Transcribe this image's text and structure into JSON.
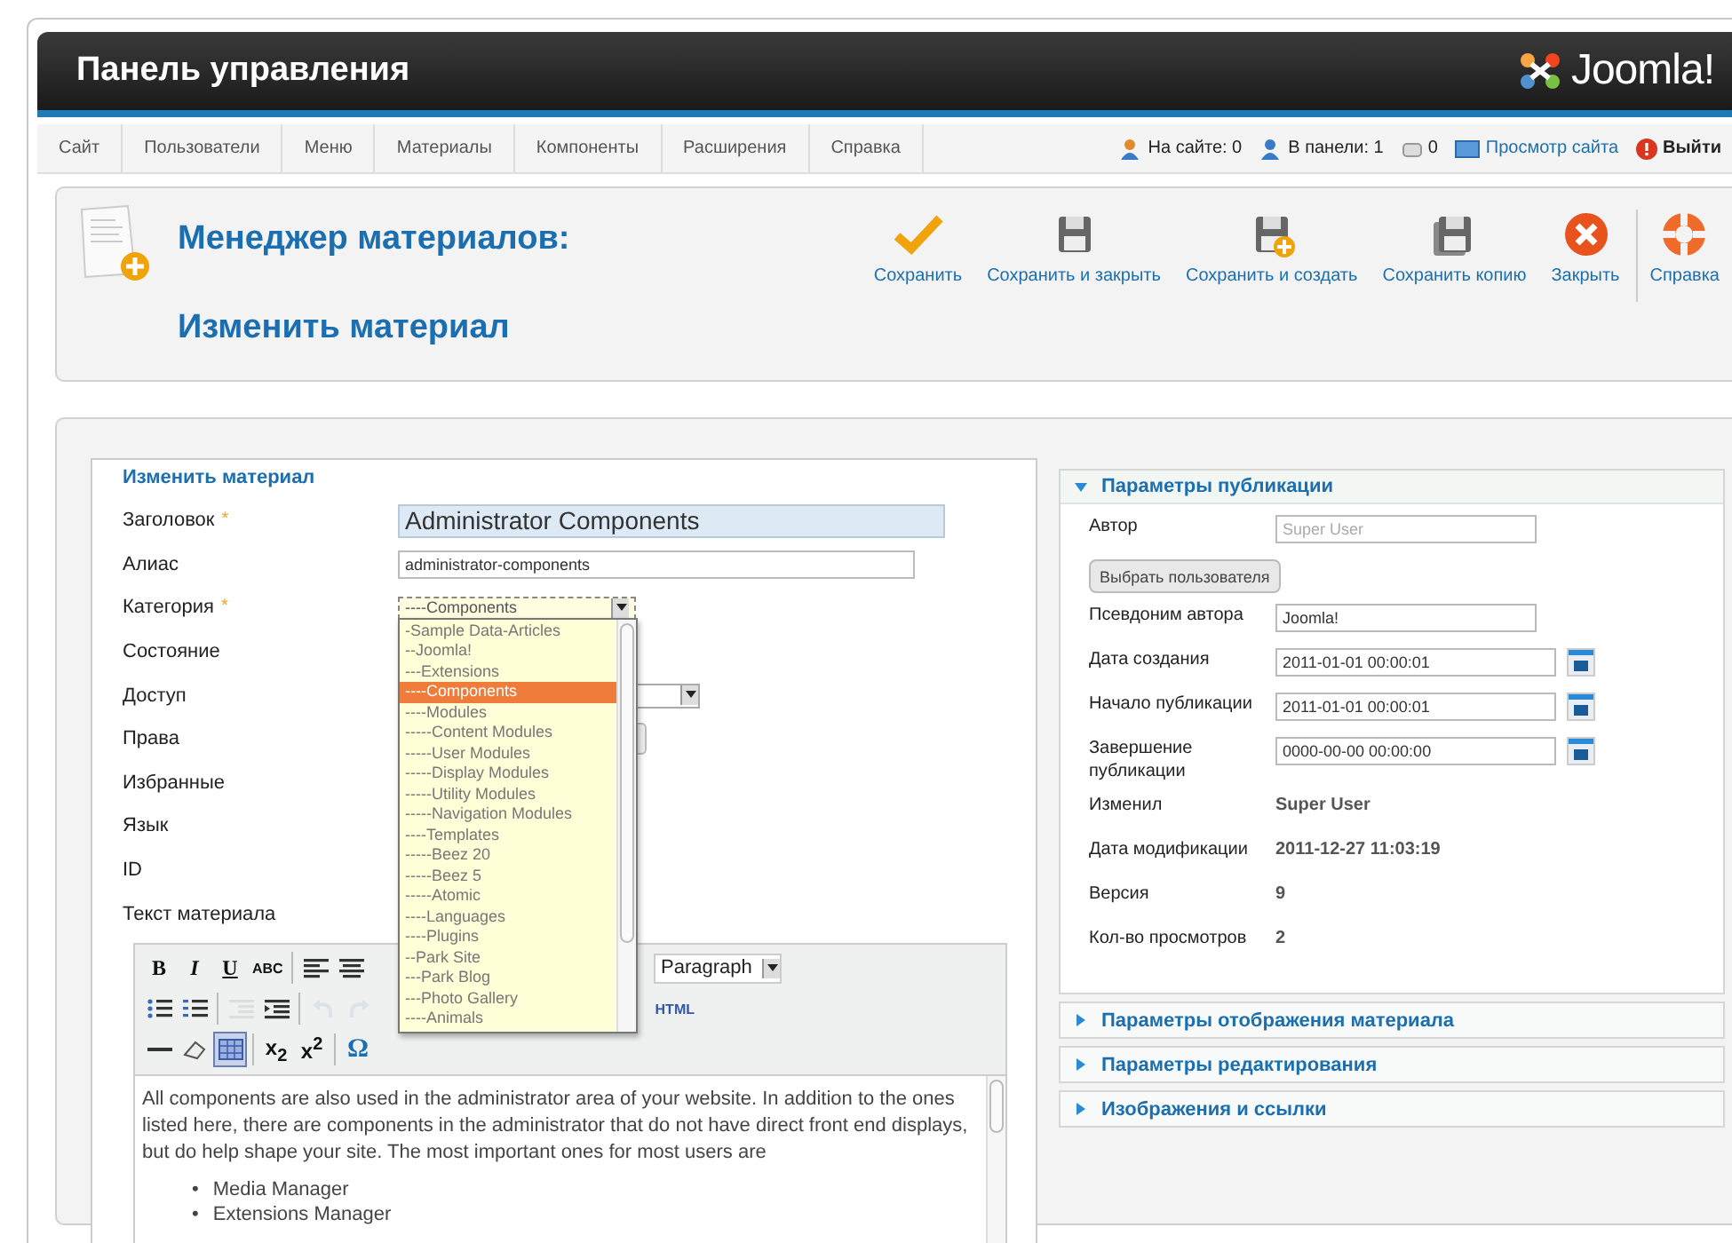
{
  "header": {
    "title": "Панель управления",
    "logo": "Joomla!"
  },
  "menu": [
    {
      "label": "Сайт"
    },
    {
      "label": "Пользователи"
    },
    {
      "label": "Меню"
    },
    {
      "label": "Материалы"
    },
    {
      "label": "Компоненты"
    },
    {
      "label": "Расширения"
    },
    {
      "label": "Справка"
    }
  ],
  "status": [
    {
      "kind": "users",
      "label": "На сайте: 0"
    },
    {
      "kind": "admins",
      "label": "В панели: 1"
    },
    {
      "kind": "messages",
      "label": "0"
    },
    {
      "kind": "preview",
      "label": "Просмотр сайта"
    },
    {
      "kind": "logout",
      "label": "Выйти"
    }
  ],
  "toolbar": {
    "title": "Менеджер материалов:",
    "subtitle": "Изменить материал",
    "buttons": [
      {
        "kind": "save",
        "label": "Сохранить"
      },
      {
        "kind": "save-close",
        "label": "Сохранить и закрыть"
      },
      {
        "kind": "save-new",
        "label": "Сохранить и создать"
      },
      {
        "kind": "save-copy",
        "label": "Сохранить копию"
      },
      {
        "kind": "close",
        "label": "Закрыть"
      },
      {
        "kind": "help",
        "label": "Справка"
      }
    ]
  },
  "form": {
    "legend": "Изменить материал",
    "fields": [
      {
        "kind": "title",
        "label": "Заголовок",
        "required_mark": "*",
        "value": "Administrator Components"
      },
      {
        "kind": "text",
        "label": "Алиас",
        "value": "administrator-components"
      },
      {
        "kind": "category",
        "label": "Категория",
        "required_mark": "*",
        "value": "----Components",
        "options": [
          {
            "label": "-Sample Data-Articles",
            "selected": false
          },
          {
            "label": "--Joomla!",
            "selected": false
          },
          {
            "label": "---Extensions",
            "selected": false
          },
          {
            "label": "----Components",
            "selected": true
          },
          {
            "label": "----Modules",
            "selected": false
          },
          {
            "label": "-----Content Modules",
            "selected": false
          },
          {
            "label": "-----User Modules",
            "selected": false
          },
          {
            "label": "-----Display Modules",
            "selected": false
          },
          {
            "label": "-----Utility Modules",
            "selected": false
          },
          {
            "label": "-----Navigation Modules",
            "selected": false
          },
          {
            "label": "----Templates",
            "selected": false
          },
          {
            "label": "-----Beez 20",
            "selected": false
          },
          {
            "label": "-----Beez 5",
            "selected": false
          },
          {
            "label": "-----Atomic",
            "selected": false
          },
          {
            "label": "----Languages",
            "selected": false
          },
          {
            "label": "----Plugins",
            "selected": false
          },
          {
            "label": "--Park Site",
            "selected": false
          },
          {
            "label": "---Park Blog",
            "selected": false
          },
          {
            "label": "---Photo Gallery",
            "selected": false
          },
          {
            "label": "----Animals",
            "selected": false
          }
        ]
      },
      {
        "kind": "plain",
        "label": "Состояние"
      },
      {
        "kind": "select",
        "label": "Доступ"
      },
      {
        "kind": "button",
        "label": "Права"
      },
      {
        "kind": "plain",
        "label": "Избранные"
      },
      {
        "kind": "plain",
        "label": "Язык"
      },
      {
        "kind": "plain",
        "label": "ID"
      }
    ],
    "editor": {
      "label": "Текст материала",
      "format": "Paragraph",
      "html_link": "HTML",
      "tools": [
        [
          {
            "kind": "bold",
            "text": "B"
          },
          {
            "kind": "italic",
            "text": "I"
          },
          {
            "kind": "underline",
            "text": "U"
          },
          {
            "kind": "strike",
            "text": "ABC"
          },
          {
            "kind": "sep"
          },
          {
            "kind": "align-left"
          },
          {
            "kind": "align-center"
          }
        ],
        [
          {
            "kind": "bullets",
            "disabled": false
          },
          {
            "kind": "numbers",
            "disabled": false
          },
          {
            "kind": "sep"
          },
          {
            "kind": "outdent",
            "disabled": true
          },
          {
            "kind": "indent",
            "disabled": false
          },
          {
            "kind": "sep"
          },
          {
            "kind": "undo",
            "disabled": true
          },
          {
            "kind": "redo",
            "disabled": true
          }
        ],
        [
          {
            "kind": "hr",
            "active": false
          },
          {
            "kind": "eraser",
            "active": false
          },
          {
            "kind": "table",
            "active": true
          },
          {
            "kind": "sep"
          },
          {
            "kind": "subscript",
            "text": "x$_{2}$",
            "active": false
          },
          {
            "kind": "superscript",
            "text": "x$^{2}$",
            "active": false
          },
          {
            "kind": "sep"
          },
          {
            "kind": "symbol",
            "text": "Ω",
            "active": false
          }
        ]
      ],
      "paragraph": "All components are also used in the administrator area of your website. In addition to the ones listed here, there are components in the administrator that do not have direct front end displays, but do help shape your site. The most important ones for most users are",
      "list": [
        {
          "marker": "•",
          "text": "Media Manager"
        },
        {
          "marker": "•",
          "text": "Extensions Manager"
        }
      ]
    }
  },
  "sidebar": {
    "sections": [
      {
        "title": "Параметры публикации",
        "expanded": true,
        "rows": [
          {
            "kind": "readonly",
            "label": "Автор",
            "placeholder": "Super User"
          },
          {
            "kind": "button",
            "label": "Выбрать пользователя"
          },
          {
            "kind": "input",
            "label": "Псевдоним автора",
            "value": "Joomla!"
          },
          {
            "kind": "date",
            "label": "Дата создания",
            "value": "2011-01-01 00:00:01"
          },
          {
            "kind": "date",
            "label": "Начало публикации",
            "value": "2011-01-01 00:00:01"
          },
          {
            "kind": "date",
            "label": "Завершение публикации",
            "value": "0000-00-00 00:00:00"
          },
          {
            "kind": "static",
            "label": "Изменил",
            "value": "Super User"
          },
          {
            "kind": "static",
            "label": "Дата модификации",
            "value": "2011-12-27 11:03:19"
          },
          {
            "kind": "static",
            "label": "Версия",
            "value": "9"
          },
          {
            "kind": "static",
            "label": "Кол-во просмотров",
            "value": "2"
          }
        ]
      },
      {
        "title": "Параметры отображения материала",
        "expanded": false
      },
      {
        "title": "Параметры редактирования",
        "expanded": false
      },
      {
        "title": "Изображения и ссылки",
        "expanded": false
      }
    ]
  }
}
